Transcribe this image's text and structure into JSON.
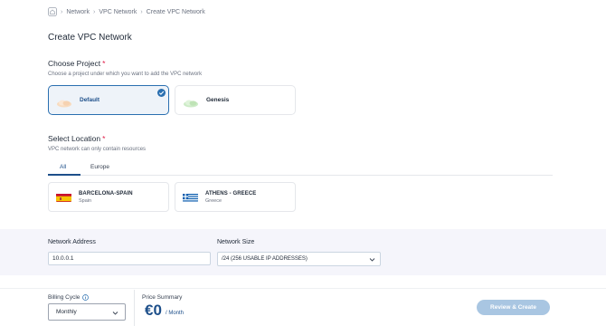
{
  "breadcrumb": {
    "items": [
      "Network",
      "VPC Network",
      "Create VPC Network"
    ]
  },
  "page_title": "Create VPC Network",
  "project_section": {
    "title": "Choose Project",
    "required_mark": "*",
    "subtitle": "Choose a project under which you want to add the VPC network",
    "projects": [
      {
        "label": "Default",
        "selected": true
      },
      {
        "label": "Genesis",
        "selected": false
      }
    ]
  },
  "location_section": {
    "title": "Select Location",
    "required_mark": "*",
    "subtitle": "VPC network can only contain resources",
    "tabs": [
      {
        "label": "All",
        "active": true
      },
      {
        "label": "Europe",
        "active": false
      }
    ],
    "locations": [
      {
        "name": "BARCELONA-SPAIN",
        "country": "Spain",
        "flag": "spain-flag"
      },
      {
        "name": "ATHENS - GREECE",
        "country": "Greece",
        "flag": "greece-flag"
      }
    ]
  },
  "network": {
    "address_label": "Network Address",
    "address_value": "10.0.0.1",
    "size_label": "Network Size",
    "size_value": "/24 (256 USABLE IP ADDRESSES)"
  },
  "footer": {
    "billing_label": "Billing Cycle",
    "billing_value": "Monthly",
    "price_label": "Price Summary",
    "price_value": "€0",
    "price_unit": "/ Month",
    "review_button": "Review & Create"
  },
  "colors": {
    "accent": "#1d4f8a",
    "selected_border": "#2a6fb0",
    "button_disabled": "#a9c6e2",
    "band": "#f5f5fb"
  }
}
